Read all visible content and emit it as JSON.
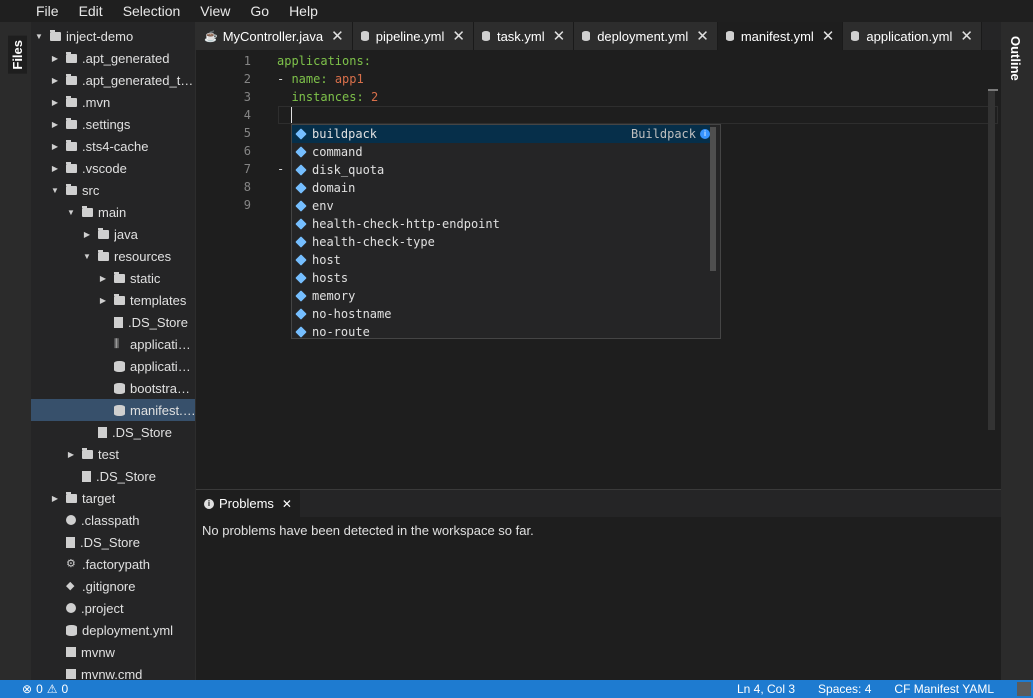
{
  "menu": [
    "File",
    "Edit",
    "Selection",
    "View",
    "Go",
    "Help"
  ],
  "left_strip": {
    "files_label": "Files"
  },
  "right_strip": {
    "outline_label": "Outline"
  },
  "file_tree": [
    {
      "label": "inject-demo",
      "twisty": "▼",
      "icon": "folder"
    },
    {
      "label": ".apt_generated",
      "twisty": "▶",
      "icon": "folder"
    },
    {
      "label": ".apt_generated_t…",
      "twisty": "▶",
      "icon": "folder"
    },
    {
      "label": ".mvn",
      "twisty": "▶",
      "icon": "folder"
    },
    {
      "label": ".settings",
      "twisty": "▶",
      "icon": "folder"
    },
    {
      "label": ".sts4-cache",
      "twisty": "▶",
      "icon": "folder"
    },
    {
      "label": ".vscode",
      "twisty": "▶",
      "icon": "folder"
    },
    {
      "label": "src",
      "twisty": "▼",
      "icon": "folder"
    },
    {
      "label": "main",
      "twisty": "▼",
      "icon": "folder"
    },
    {
      "label": "java",
      "twisty": "▶",
      "icon": "folder"
    },
    {
      "label": "resources",
      "twisty": "▼",
      "icon": "folder"
    },
    {
      "label": "static",
      "twisty": "▶",
      "icon": "folder"
    },
    {
      "label": "templates",
      "twisty": "▶",
      "icon": "folder"
    },
    {
      "label": ".DS_Store",
      "twisty": "",
      "icon": "file"
    },
    {
      "label": "applicati…",
      "twisty": "",
      "icon": "bars"
    },
    {
      "label": "applicati…",
      "twisty": "",
      "icon": "db"
    },
    {
      "label": "bootstra…",
      "twisty": "",
      "icon": "db"
    },
    {
      "label": "manifest.…",
      "twisty": "",
      "icon": "db",
      "selected": true
    },
    {
      "label": ".DS_Store",
      "twisty": "",
      "icon": "file"
    },
    {
      "label": "test",
      "twisty": "▶",
      "icon": "folder"
    },
    {
      "label": ".DS_Store",
      "twisty": "",
      "icon": "file"
    },
    {
      "label": "target",
      "twisty": "▶",
      "icon": "folder"
    },
    {
      "label": ".classpath",
      "twisty": "",
      "icon": "circle"
    },
    {
      "label": ".DS_Store",
      "twisty": "",
      "icon": "file"
    },
    {
      "label": ".factorypath",
      "twisty": "",
      "icon": "gear"
    },
    {
      "label": ".gitignore",
      "twisty": "",
      "icon": "diamond"
    },
    {
      "label": ".project",
      "twisty": "",
      "icon": "circle"
    },
    {
      "label": "deployment.yml",
      "twisty": "",
      "icon": "db"
    },
    {
      "label": "mvnw",
      "twisty": "",
      "icon": "grid"
    },
    {
      "label": "mvnw.cmd",
      "twisty": "",
      "icon": "grid"
    }
  ],
  "tabs": [
    {
      "label": "MyController.java",
      "icon": "java"
    },
    {
      "label": "pipeline.yml",
      "icon": "yaml"
    },
    {
      "label": "task.yml",
      "icon": "yaml"
    },
    {
      "label": "deployment.yml",
      "icon": "yaml"
    },
    {
      "label": "manifest.yml",
      "icon": "yaml",
      "active": true
    },
    {
      "label": "application.yml",
      "icon": "yaml"
    }
  ],
  "editor": {
    "line_numbers": [
      "1",
      "2",
      "3",
      "4",
      "5",
      "6",
      "7",
      "8",
      "9"
    ],
    "lines": [
      {
        "indent": "",
        "dash": "",
        "key": "applications:",
        "value": ""
      },
      {
        "indent": "",
        "dash": "- ",
        "key": "name: ",
        "value": "app1"
      },
      {
        "indent": "  ",
        "dash": "",
        "key": "instances: ",
        "value": "2"
      },
      {
        "indent": "",
        "dash": "",
        "key": "",
        "value": ""
      },
      {
        "indent": "",
        "dash": "",
        "key": "",
        "value": ""
      },
      {
        "indent": "",
        "dash": "",
        "key": "",
        "value": ""
      },
      {
        "indent": "",
        "dash": "-",
        "key": "",
        "value": ""
      },
      {
        "indent": "",
        "dash": "",
        "key": "",
        "value": ""
      },
      {
        "indent": "",
        "dash": "",
        "key": "",
        "value": ""
      }
    ]
  },
  "suggestions": {
    "items": [
      "buildpack",
      "command",
      "disk_quota",
      "domain",
      "env",
      "health-check-http-endpoint",
      "health-check-type",
      "host",
      "hosts",
      "memory",
      "no-hostname",
      "no-route"
    ],
    "focused_detail": "Buildpack",
    "info_glyph": "i"
  },
  "problems": {
    "tab_label": "Problems",
    "close_glyph": "✕",
    "message": "No problems have been detected in the workspace so far."
  },
  "statusbar": {
    "errors_icon": "⊗",
    "errors": "0",
    "warnings_icon": "⚠",
    "warnings": "0",
    "position": "Ln 4, Col 3",
    "spaces": "Spaces: 4",
    "language": "CF Manifest YAML"
  },
  "colors": {
    "accent": "#1e7bd0",
    "yaml_key": "#7ec24a",
    "yaml_value": "#d86f4a",
    "selection": "#37506b"
  }
}
